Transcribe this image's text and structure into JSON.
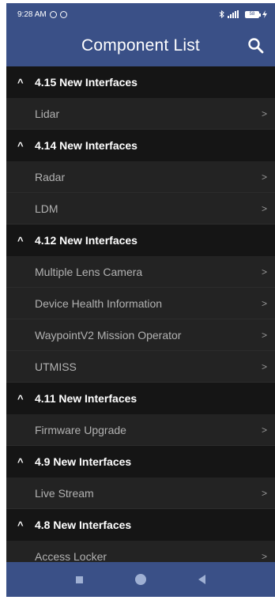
{
  "status_bar": {
    "time": "9:28 AM",
    "battery": "58"
  },
  "header": {
    "title": "Component List"
  },
  "sections": [
    {
      "title": "4.15 New Interfaces",
      "items": [
        "Lidar"
      ]
    },
    {
      "title": "4.14 New Interfaces",
      "items": [
        "Radar",
        "LDM"
      ]
    },
    {
      "title": "4.12 New Interfaces",
      "items": [
        "Multiple Lens Camera",
        "Device Health Information",
        "WaypointV2 Mission Operator",
        "UTMISS"
      ]
    },
    {
      "title": "4.11 New Interfaces",
      "items": [
        "Firmware Upgrade"
      ]
    },
    {
      "title": "4.9 New Interfaces",
      "items": [
        "Live Stream"
      ]
    },
    {
      "title": "4.8 New Interfaces",
      "items": [
        "Access Locker"
      ]
    }
  ],
  "glyphs": {
    "caret": "^",
    "chevron": ">"
  },
  "colors": {
    "primary": "#3a5087",
    "list_bg": "#232323",
    "section_bg": "#151515"
  },
  "icons": {
    "search": "search-icon"
  }
}
